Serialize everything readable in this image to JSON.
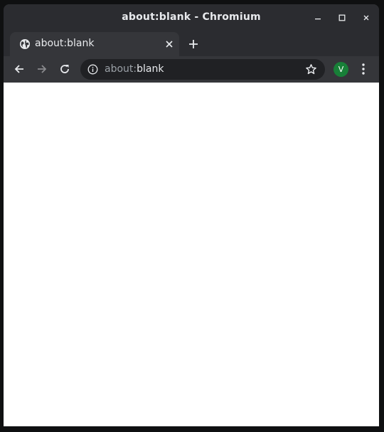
{
  "window": {
    "title": "about:blank - Chromium"
  },
  "titlebar_buttons": {
    "minimize_icon": "minimize-icon",
    "maximize_icon": "maximize-icon",
    "close_icon": "close-icon"
  },
  "tab": {
    "title": "about:blank",
    "favicon": "globe-icon",
    "close_icon": "close-icon"
  },
  "new_tab_icon": "plus-icon",
  "toolbar": {
    "back_icon": "back-arrow-icon",
    "forward_icon": "forward-arrow-icon",
    "reload_icon": "reload-icon"
  },
  "omnibox": {
    "security_icon": "info-icon",
    "url_scheme": "about:",
    "url_rest": "blank",
    "bookmark_icon": "star-icon"
  },
  "profile": {
    "initial": "V",
    "color": "#188038"
  },
  "menu_icon": "three-dot-menu-icon",
  "colors": {
    "frame": "#2b2c30",
    "toolbar": "#35363a",
    "omnibox": "#202124",
    "text": "#e8eaed",
    "page": "#ffffff"
  }
}
